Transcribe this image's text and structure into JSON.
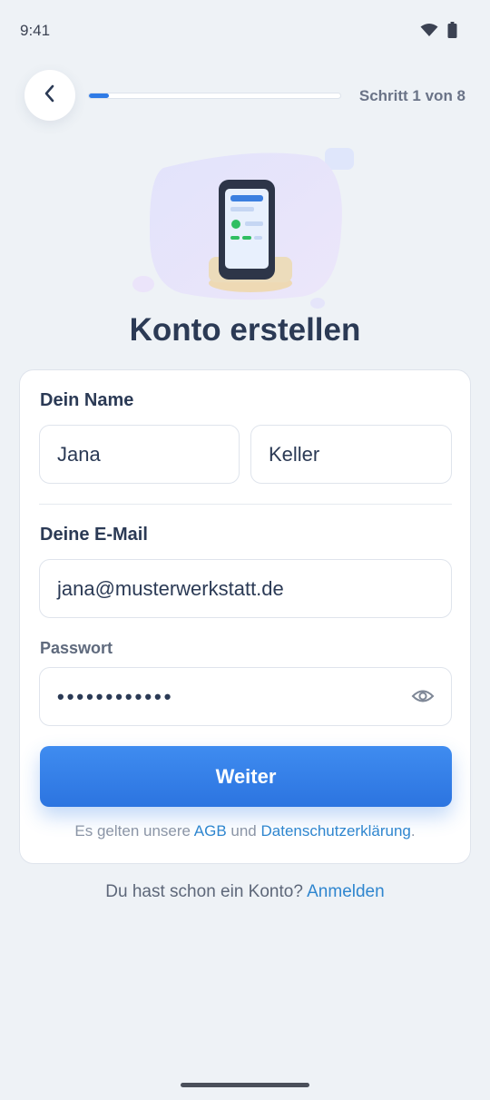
{
  "status_bar": {
    "time": "9:41"
  },
  "header": {
    "step_label": "Schritt 1 von 8",
    "progress_fraction": 0.08
  },
  "page": {
    "title": "Konto erstellen"
  },
  "form": {
    "name_label": "Dein Name",
    "first_name_value": "Jana",
    "last_name_value": "Keller",
    "email_label": "Deine E-Mail",
    "email_value": "jana@musterwerkstatt.de",
    "password_label": "Passwort",
    "password_masked": "••••••••••••",
    "submit_label": "Weiter",
    "terms_prefix": "Es gelten unsere ",
    "terms_link": "AGB",
    "terms_middle": " und ",
    "privacy_link": "Datenschutzerklärung",
    "terms_suffix": "."
  },
  "footer": {
    "signin_prompt": "Du hast schon ein Konto? ",
    "signin_link": "Anmelden"
  },
  "icons": {
    "back": "chevron-left-icon",
    "password_toggle": "eye-icon",
    "wifi": "wifi-icon",
    "battery": "battery-icon"
  },
  "colors": {
    "accent": "#2f7be6",
    "link": "#2f86cf",
    "background": "#eef2f6",
    "text": "#2b3a55"
  }
}
